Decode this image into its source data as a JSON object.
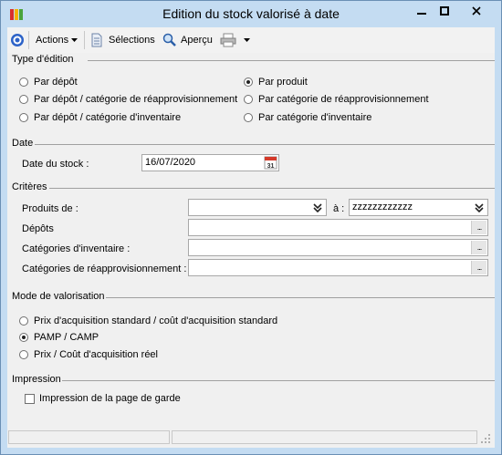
{
  "window": {
    "title": "Edition du stock valorisé à date"
  },
  "toolbar": {
    "actions_label": "Actions",
    "selections_label": "Sélections",
    "apercu_label": "Aperçu"
  },
  "type_edition": {
    "heading": "Type d'édition",
    "options": [
      {
        "label": "Par dépôt",
        "checked": false
      },
      {
        "label": "Par dépôt / catégorie de réapprovisionnement",
        "checked": false
      },
      {
        "label": "Par dépôt / catégorie d'inventaire",
        "checked": false
      },
      {
        "label": "Par produit",
        "checked": true
      },
      {
        "label": "Par catégorie de réapprovisionnement",
        "checked": false
      },
      {
        "label": "Par catégorie d'inventaire",
        "checked": false
      }
    ]
  },
  "date": {
    "heading": "Date",
    "label": "Date du stock :",
    "value": "16/07/2020",
    "calendar_day": "31"
  },
  "criteres": {
    "heading": "Critères",
    "produits_label": "Produits de :",
    "produits_from": "",
    "a_label": "à :",
    "produits_to": "zzzzzzzzzzzz",
    "depots_label": "Dépôts",
    "depots_value": "",
    "cat_inv_label": "Catégories d'inventaire :",
    "cat_inv_value": "",
    "cat_reappro_label": "Catégories de réapprovisionnement :",
    "cat_reappro_value": "",
    "ellipsis": "..."
  },
  "valorisation": {
    "heading": "Mode de valorisation",
    "options": [
      {
        "label": "Prix d'acquisition standard / coût d'acquisition standard",
        "checked": false
      },
      {
        "label": "PAMP / CAMP",
        "checked": true
      },
      {
        "label": "Prix / Coût d'acquisition réel",
        "checked": false
      }
    ]
  },
  "impression": {
    "heading": "Impression",
    "page_garde_label": "Impression de la page de garde",
    "page_garde_checked": false
  }
}
